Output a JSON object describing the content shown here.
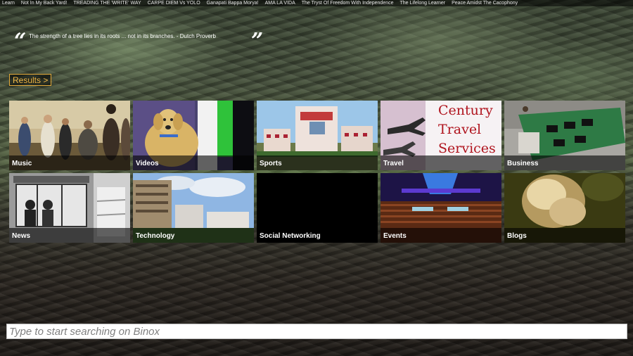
{
  "nav": {
    "links": [
      "Learn",
      "Not In My Back Yard!",
      "TREADING THE 'WRITE' WAY",
      "CARPE DIEM Vs YOLO",
      "Ganapati Bappa Morya!",
      "AMA LA VIDA",
      "The Tryst Of Freedom With Independence",
      "The Lifelong Learner",
      "Peace Amidst The Cacophony"
    ]
  },
  "quote": {
    "open_mark": "“",
    "close_mark": "”",
    "text": "The strength of a tree lies in its roots ... not in its branches. - Dutch Proverb"
  },
  "results_button": "Results >",
  "tiles": [
    {
      "label": "Music"
    },
    {
      "label": "Videos"
    },
    {
      "label": "Sports"
    },
    {
      "label": "Travel",
      "thumb_text": "Century Travel Services"
    },
    {
      "label": "Business"
    },
    {
      "label": "News"
    },
    {
      "label": "Technology"
    },
    {
      "label": "Social Networking"
    },
    {
      "label": "Events"
    },
    {
      "label": "Blogs"
    }
  ],
  "search": {
    "placeholder": "Type to start searching on Binox"
  }
}
